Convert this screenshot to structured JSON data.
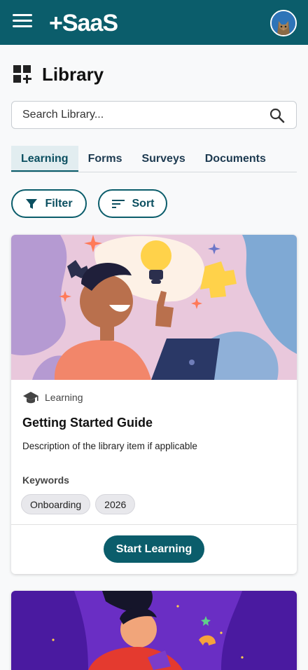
{
  "header": {
    "logo_text": "+SaaS",
    "brand_color": "#0b5d6b"
  },
  "page": {
    "title": "Library"
  },
  "search": {
    "placeholder": "Search Library..."
  },
  "tabs": [
    {
      "label": "Learning",
      "active": true
    },
    {
      "label": "Forms",
      "active": false
    },
    {
      "label": "Surveys",
      "active": false
    },
    {
      "label": "Documents",
      "active": false
    }
  ],
  "toolbar": {
    "filter_label": "Filter",
    "sort_label": "Sort"
  },
  "cards": [
    {
      "category": "Learning",
      "title": "Getting Started Guide",
      "description": "Description of the library item if applicable",
      "keywords_label": "Keywords",
      "keywords": [
        "Onboarding",
        "2026"
      ],
      "action_label": "Start Learning"
    }
  ],
  "icons": {
    "menu": "hamburger-menu-icon",
    "avatar": "cat-avatar",
    "page": "grid-add-icon",
    "search": "search-icon",
    "filter": "funnel-icon",
    "sort": "sort-lines-icon",
    "category": "graduation-cap-icon"
  }
}
